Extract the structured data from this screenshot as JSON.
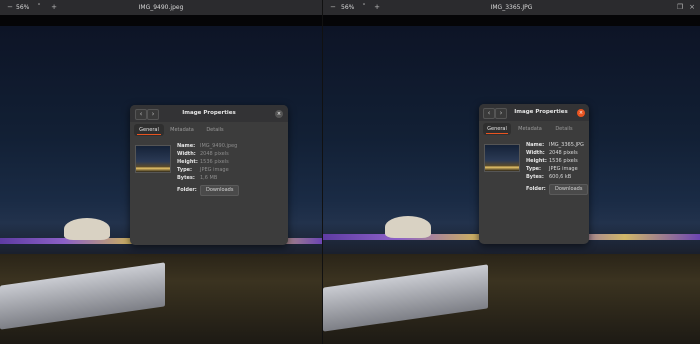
{
  "left_window": {
    "zoom": "56%",
    "title": "IMG_9490.jpeg",
    "dialog": {
      "title": "Image Properties",
      "tabs": [
        "General",
        "Metadata",
        "Details"
      ],
      "active_tab": "General",
      "labels": {
        "name": "Name:",
        "width": "Width:",
        "height": "Height:",
        "type": "Type:",
        "bytes": "Bytes:",
        "folder": "Folder:"
      },
      "values": {
        "name": "IMG_9490.jpeg",
        "width": "2048 pixels",
        "height": "1536 pixels",
        "type": "JPEG image",
        "bytes": "1,6 MB"
      },
      "folder_button": "Downloads"
    }
  },
  "right_window": {
    "zoom": "56%",
    "title": "IMG_3365.JPG",
    "dialog": {
      "title": "Image Properties",
      "tabs": [
        "General",
        "Metadata",
        "Details"
      ],
      "active_tab": "General",
      "labels": {
        "name": "Name:",
        "width": "Width:",
        "height": "Height:",
        "type": "Type:",
        "bytes": "Bytes:",
        "folder": "Folder:"
      },
      "values": {
        "name": "IMG_3365.JPG",
        "width": "2048 pixels",
        "height": "1536 pixels",
        "type": "JPEG image",
        "bytes": "600,6 kB"
      },
      "folder_button": "Downloads"
    }
  },
  "icons": {
    "zoom_out": "−",
    "zoom_in": "+",
    "dropdown": "˅",
    "prev": "‹",
    "next": "›",
    "close": "×",
    "restore": "❐"
  },
  "colors": {
    "accent": "#e95420",
    "dialog_bg": "#3c3c3c",
    "titlebar": "#2b2b2e"
  }
}
